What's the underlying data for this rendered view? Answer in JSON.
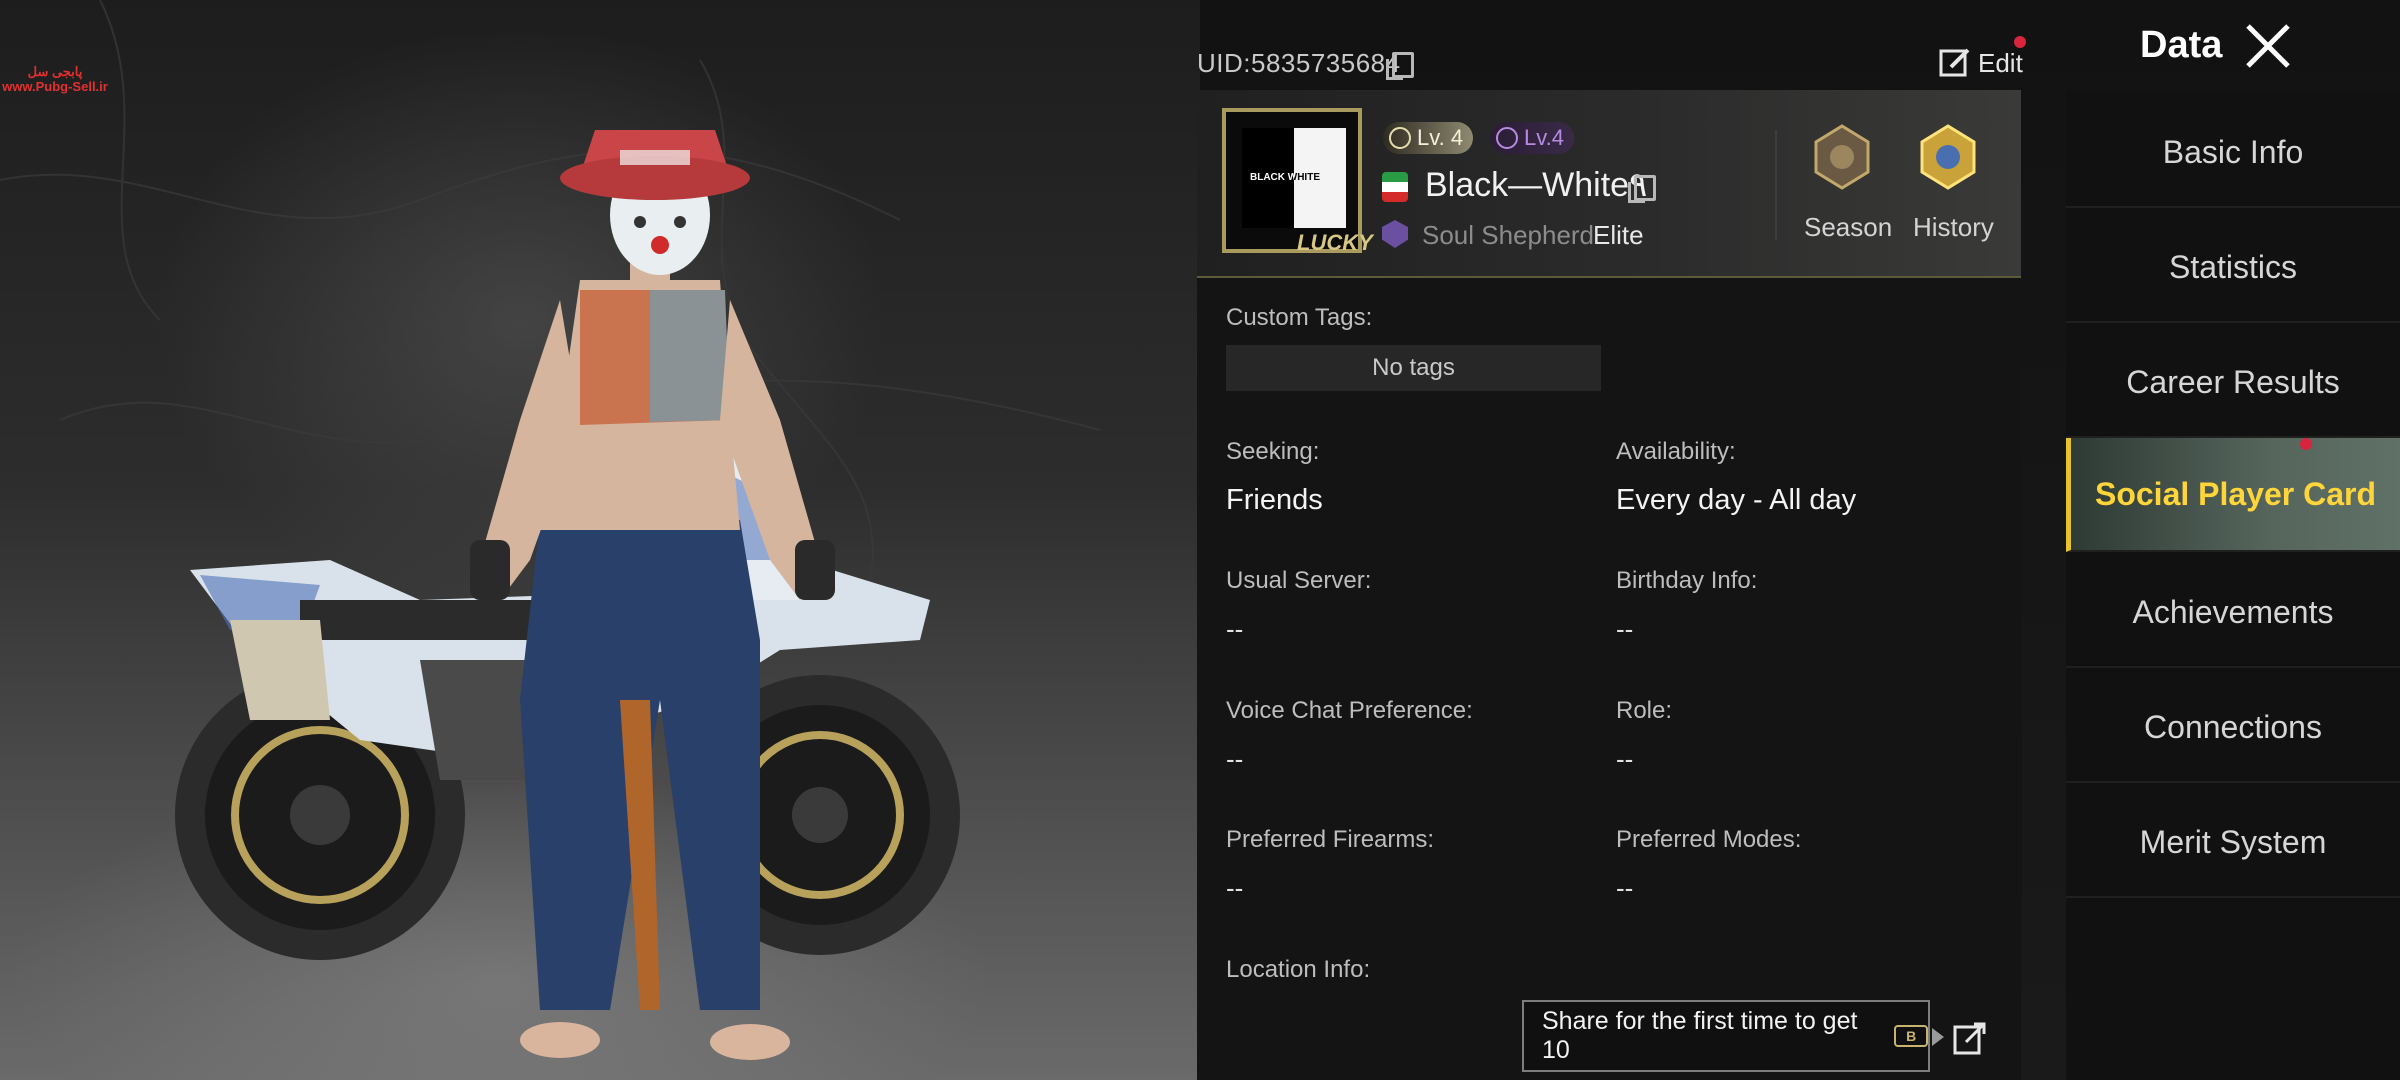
{
  "watermark": {
    "line1": "پابجی سل",
    "line2": "www.Pubg-Sell.ir"
  },
  "profile": {
    "uid": "UID:5835735684",
    "edit_label": "Edit",
    "frame_text": "BLACK WHITE",
    "frame_banner": "LUCKY",
    "level_1": "Lv. 4",
    "level_2": "Lv.4",
    "player_name": "Black—White٩",
    "clan_name": "Soul Shepherd",
    "clan_rank": "Elite",
    "season_label": "Season",
    "history_label": "History"
  },
  "card": {
    "custom_tags_label": "Custom Tags:",
    "no_tags": "No tags",
    "seeking_label": "Seeking:",
    "seeking_value": "Friends",
    "availability_label": "Availability:",
    "availability_value": "Every day - All day",
    "usual_server_label": "Usual Server:",
    "usual_server_value": "--",
    "birthday_label": "Birthday Info:",
    "birthday_value": "--",
    "voice_chat_label": "Voice Chat Preference:",
    "voice_chat_value": "--",
    "role_label": "Role:",
    "role_value": "--",
    "firearms_label": "Preferred Firearms:",
    "firearms_value": "--",
    "modes_label": "Preferred Modes:",
    "modes_value": "--",
    "location_label": "Location Info:",
    "share_text": "Share for the first time to get 10",
    "coin_symbol": "B"
  },
  "sidebar": {
    "title": "Data",
    "items": [
      {
        "label": "Basic Info"
      },
      {
        "label": "Statistics"
      },
      {
        "label": "Career Results"
      },
      {
        "label": "Social Player Card"
      },
      {
        "label": "Achievements"
      },
      {
        "label": "Connections"
      },
      {
        "label": "Merit System"
      }
    ]
  },
  "colors": {
    "accent": "#ffd53a",
    "notification": "#d8243c",
    "active_tab": "#55655c"
  }
}
